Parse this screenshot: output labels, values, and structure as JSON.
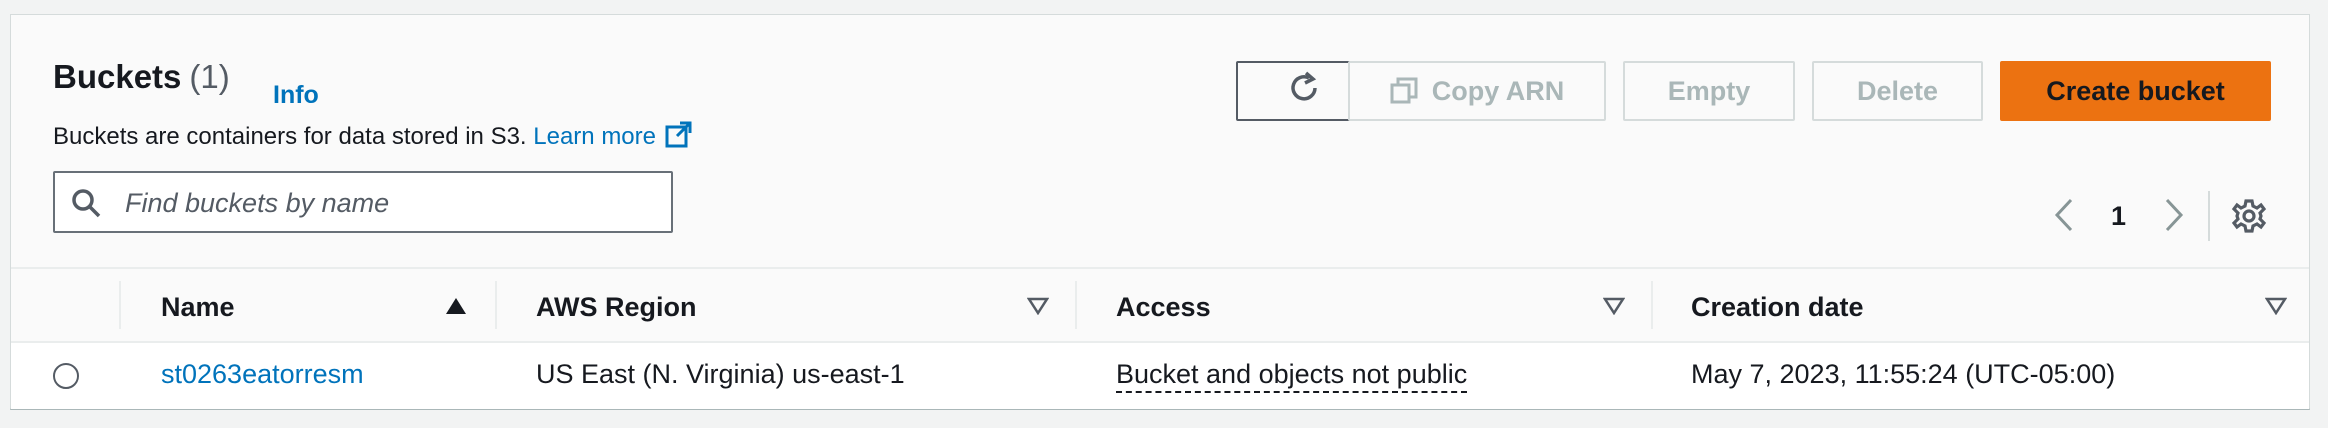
{
  "header": {
    "title": "Buckets",
    "count": "(1)",
    "info_label": "Info",
    "description": "Buckets are containers for data stored in S3. ",
    "learn_more_label": "Learn more"
  },
  "toolbar": {
    "copy_arn_label": "Copy ARN",
    "empty_label": "Empty",
    "delete_label": "Delete",
    "create_label": "Create bucket"
  },
  "search": {
    "placeholder": "Find buckets by name",
    "value": ""
  },
  "pagination": {
    "current_page": "1"
  },
  "table": {
    "columns": [
      "Name",
      "AWS Region",
      "Access",
      "Creation date"
    ],
    "sorted_by": "Name",
    "sort_direction": "ascending",
    "rows": [
      {
        "name": "st0263eatorresm",
        "region": "US East (N. Virginia) us-east-1",
        "access": "Bucket and objects not public",
        "creation_date": "May 7, 2023, 11:55:24 (UTC-05:00)"
      }
    ]
  },
  "icons": [
    "refresh-icon",
    "copy-icon",
    "external-link-icon",
    "search-icon",
    "chevron-left-icon",
    "chevron-right-icon",
    "settings-gear-icon",
    "sort-ascending-icon",
    "sort-descending-icon"
  ],
  "colors": {
    "accent_orange": "#ec7211",
    "link_blue": "#0073bb",
    "text_dark": "#16191f",
    "disabled_gray": "#aab7b8"
  }
}
